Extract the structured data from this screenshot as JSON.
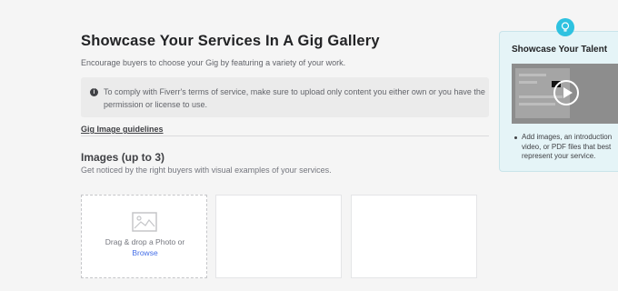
{
  "header": {
    "title": "Showcase Your Services In A Gig Gallery",
    "subtitle": "Encourage buyers to choose your Gig by featuring a variety of your work."
  },
  "notice": {
    "icon": "info-icon",
    "text": "To comply with Fiverr's terms of service, make sure to upload only content you either own or you have the permission or license to use."
  },
  "guidelines_link": "Gig Image guidelines",
  "images_section": {
    "title": "Images (up to 3)",
    "subtitle": "Get noticed by the right buyers with visual examples of your services.",
    "drop_text": "Drag & drop a Photo or",
    "browse_label": "Browse",
    "slot_icon": "image-icon"
  },
  "tip": {
    "icon": "lightbulb-icon",
    "title": "Showcase Your Talent",
    "video_icon": "play-icon",
    "bullets": [
      "Add images, an introduction video, or PDF files that best represent your service."
    ]
  },
  "colors": {
    "accent": "#446ee7",
    "tip_background": "#e5f4f7",
    "bulb": "#2ec2e0"
  }
}
